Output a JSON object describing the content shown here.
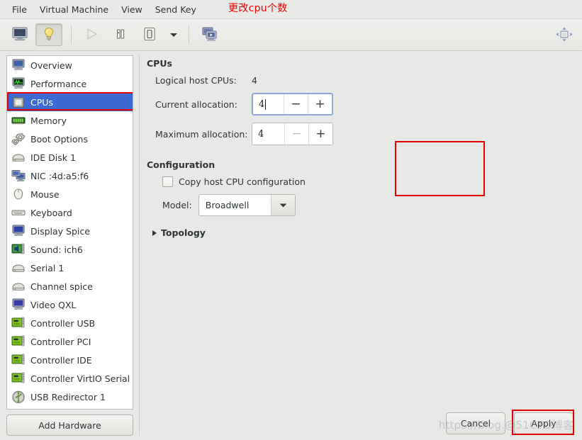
{
  "menubar": {
    "items": [
      {
        "label": "File",
        "name": "menu-file"
      },
      {
        "label": "Virtual Machine",
        "name": "menu-virtual-machine"
      },
      {
        "label": "View",
        "name": "menu-view"
      },
      {
        "label": "Send Key",
        "name": "menu-send-key"
      }
    ],
    "annotation": "更改cpu个数"
  },
  "toolbar": {
    "buttons": [
      {
        "name": "show-console-button",
        "icon": "monitor-icon",
        "state": "normal"
      },
      {
        "name": "show-details-button",
        "icon": "lightbulb-icon",
        "state": "pressed"
      },
      {
        "name": "run-button",
        "icon": "play-icon",
        "state": "disabled"
      },
      {
        "name": "pause-button",
        "icon": "pause-icon",
        "state": "normal"
      },
      {
        "name": "shutdown-button",
        "icon": "power-icon",
        "state": "normal"
      },
      {
        "name": "shutdown-menu-button",
        "icon": "chevron-down-icon",
        "state": "normal"
      },
      {
        "name": "snapshots-button",
        "icon": "snapshots-icon",
        "state": "normal"
      }
    ],
    "right_button": {
      "name": "fullscreen-button",
      "icon": "resize-vm-icon"
    }
  },
  "sidebar": {
    "items": [
      {
        "label": "Overview",
        "icon": "overview-monitor-icon",
        "selected": false
      },
      {
        "label": "Performance",
        "icon": "performance-graph-icon",
        "selected": false
      },
      {
        "label": "CPUs",
        "icon": "cpu-chip-icon",
        "selected": true
      },
      {
        "label": "Memory",
        "icon": "memory-stick-icon",
        "selected": false
      },
      {
        "label": "Boot Options",
        "icon": "gears-icon",
        "selected": false
      },
      {
        "label": "IDE Disk 1",
        "icon": "harddisk-icon",
        "selected": false
      },
      {
        "label": "NIC :4d:a5:f6",
        "icon": "network-card-icon",
        "selected": false
      },
      {
        "label": "Mouse",
        "icon": "mouse-icon",
        "selected": false
      },
      {
        "label": "Keyboard",
        "icon": "keyboard-icon",
        "selected": false
      },
      {
        "label": "Display Spice",
        "icon": "display-icon",
        "selected": false
      },
      {
        "label": "Sound: ich6",
        "icon": "sound-card-icon",
        "selected": false
      },
      {
        "label": "Serial 1",
        "icon": "serial-port-icon",
        "selected": false
      },
      {
        "label": "Channel spice",
        "icon": "serial-port-icon",
        "selected": false
      },
      {
        "label": "Video QXL",
        "icon": "video-card-icon",
        "selected": false
      },
      {
        "label": "Controller USB",
        "icon": "controller-card-icon",
        "selected": false
      },
      {
        "label": "Controller PCI",
        "icon": "controller-card-icon",
        "selected": false
      },
      {
        "label": "Controller IDE",
        "icon": "controller-card-icon",
        "selected": false
      },
      {
        "label": "Controller VirtIO Serial",
        "icon": "controller-card-icon",
        "selected": false
      },
      {
        "label": "USB Redirector 1",
        "icon": "usb-icon",
        "selected": false
      }
    ],
    "add_hardware_label": "Add Hardware"
  },
  "main": {
    "section_title": "CPUs",
    "logical_host_cpus": {
      "label": "Logical host CPUs:",
      "value": "4"
    },
    "current_allocation": {
      "label": "Current allocation:",
      "value": "4",
      "minus": "−",
      "plus": "+",
      "focused": true,
      "minus_enabled": true
    },
    "maximum_allocation": {
      "label": "Maximum allocation:",
      "value": "4",
      "minus": "−",
      "plus": "+",
      "focused": false,
      "minus_enabled": false
    },
    "configuration": {
      "title": "Configuration",
      "copy_host_cpu_label": "Copy host CPU configuration",
      "copy_host_cpu_checked": false,
      "model_label": "Model:",
      "model_value": "Broadwell",
      "topology_label": "Topology",
      "topology_expanded": false
    }
  },
  "footer": {
    "cancel_label": "Cancel",
    "apply_label": "Apply",
    "watermark": "https://blog.@51CTO博客"
  },
  "colors": {
    "selection_blue": "#3d69d4",
    "annotation_red": "#e40000",
    "window_bg": "#e8e8e6",
    "list_bg": "#ffffff"
  }
}
